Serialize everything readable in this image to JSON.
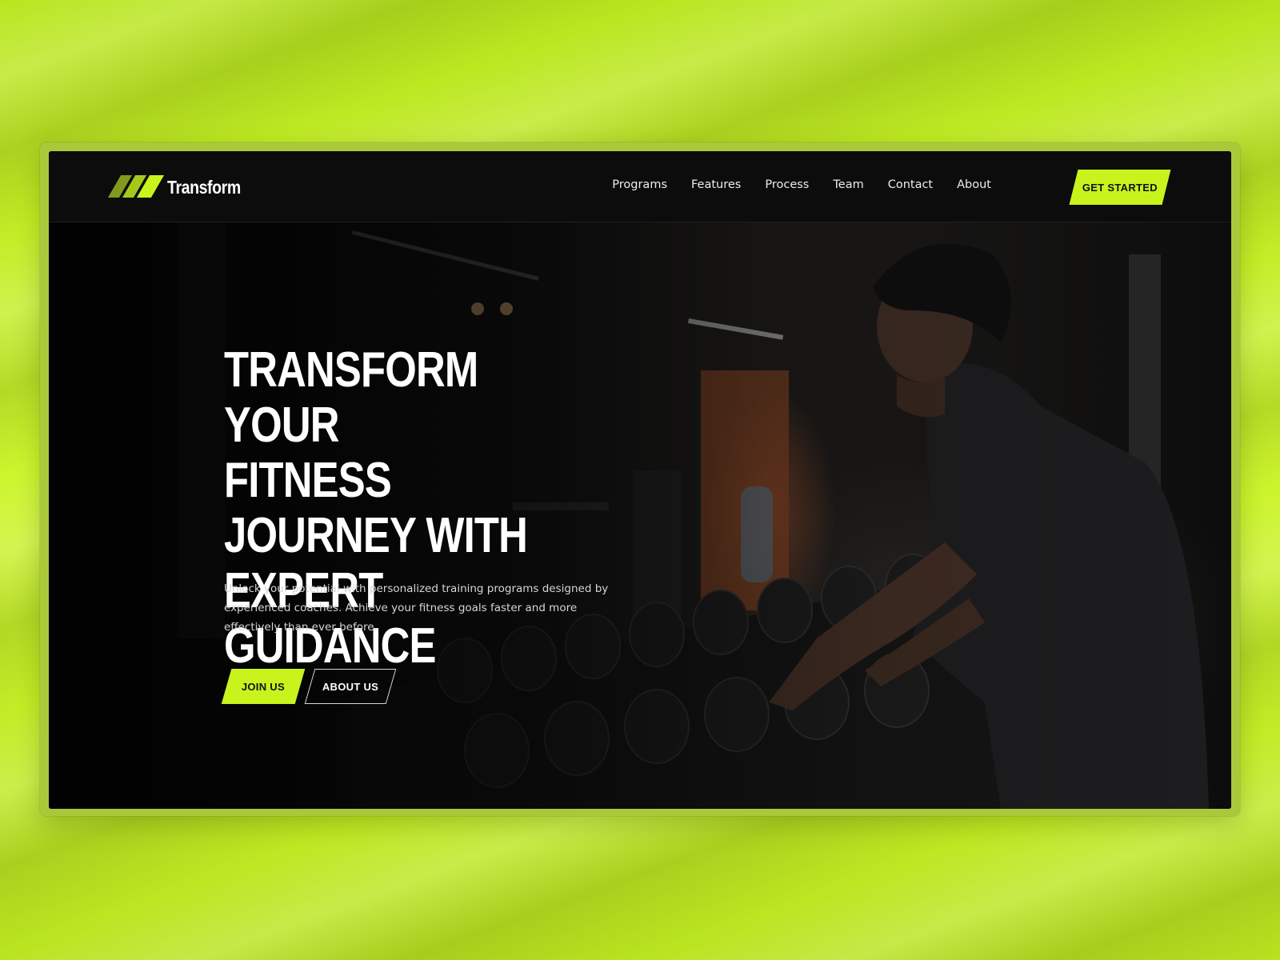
{
  "brand": {
    "name": "Transform",
    "accent": "#c8f31d",
    "logo_icon": "three-slash-stripes-icon"
  },
  "nav": {
    "links": [
      "Programs",
      "Features",
      "Process",
      "Team",
      "Contact",
      "About"
    ],
    "cta_label": "GET STARTED"
  },
  "hero": {
    "headline_lines": [
      "TRANSFORM YOUR",
      "FITNESS",
      "JOURNEY WITH EXPERT",
      "GUIDANCE"
    ],
    "subtext": "Unlock your potential with personalized training programs designed by experienced coaches. Achieve your fitness goals faster and more effectively than ever before.",
    "primary_button": "JOIN US",
    "secondary_button": "ABOUT US",
    "background_image": "man-at-gym-dumbbell-rack-photo"
  },
  "colors": {
    "page_background": "#c4ee26",
    "nav_background": "#0c0c0c",
    "accent": "#c8f31d"
  }
}
